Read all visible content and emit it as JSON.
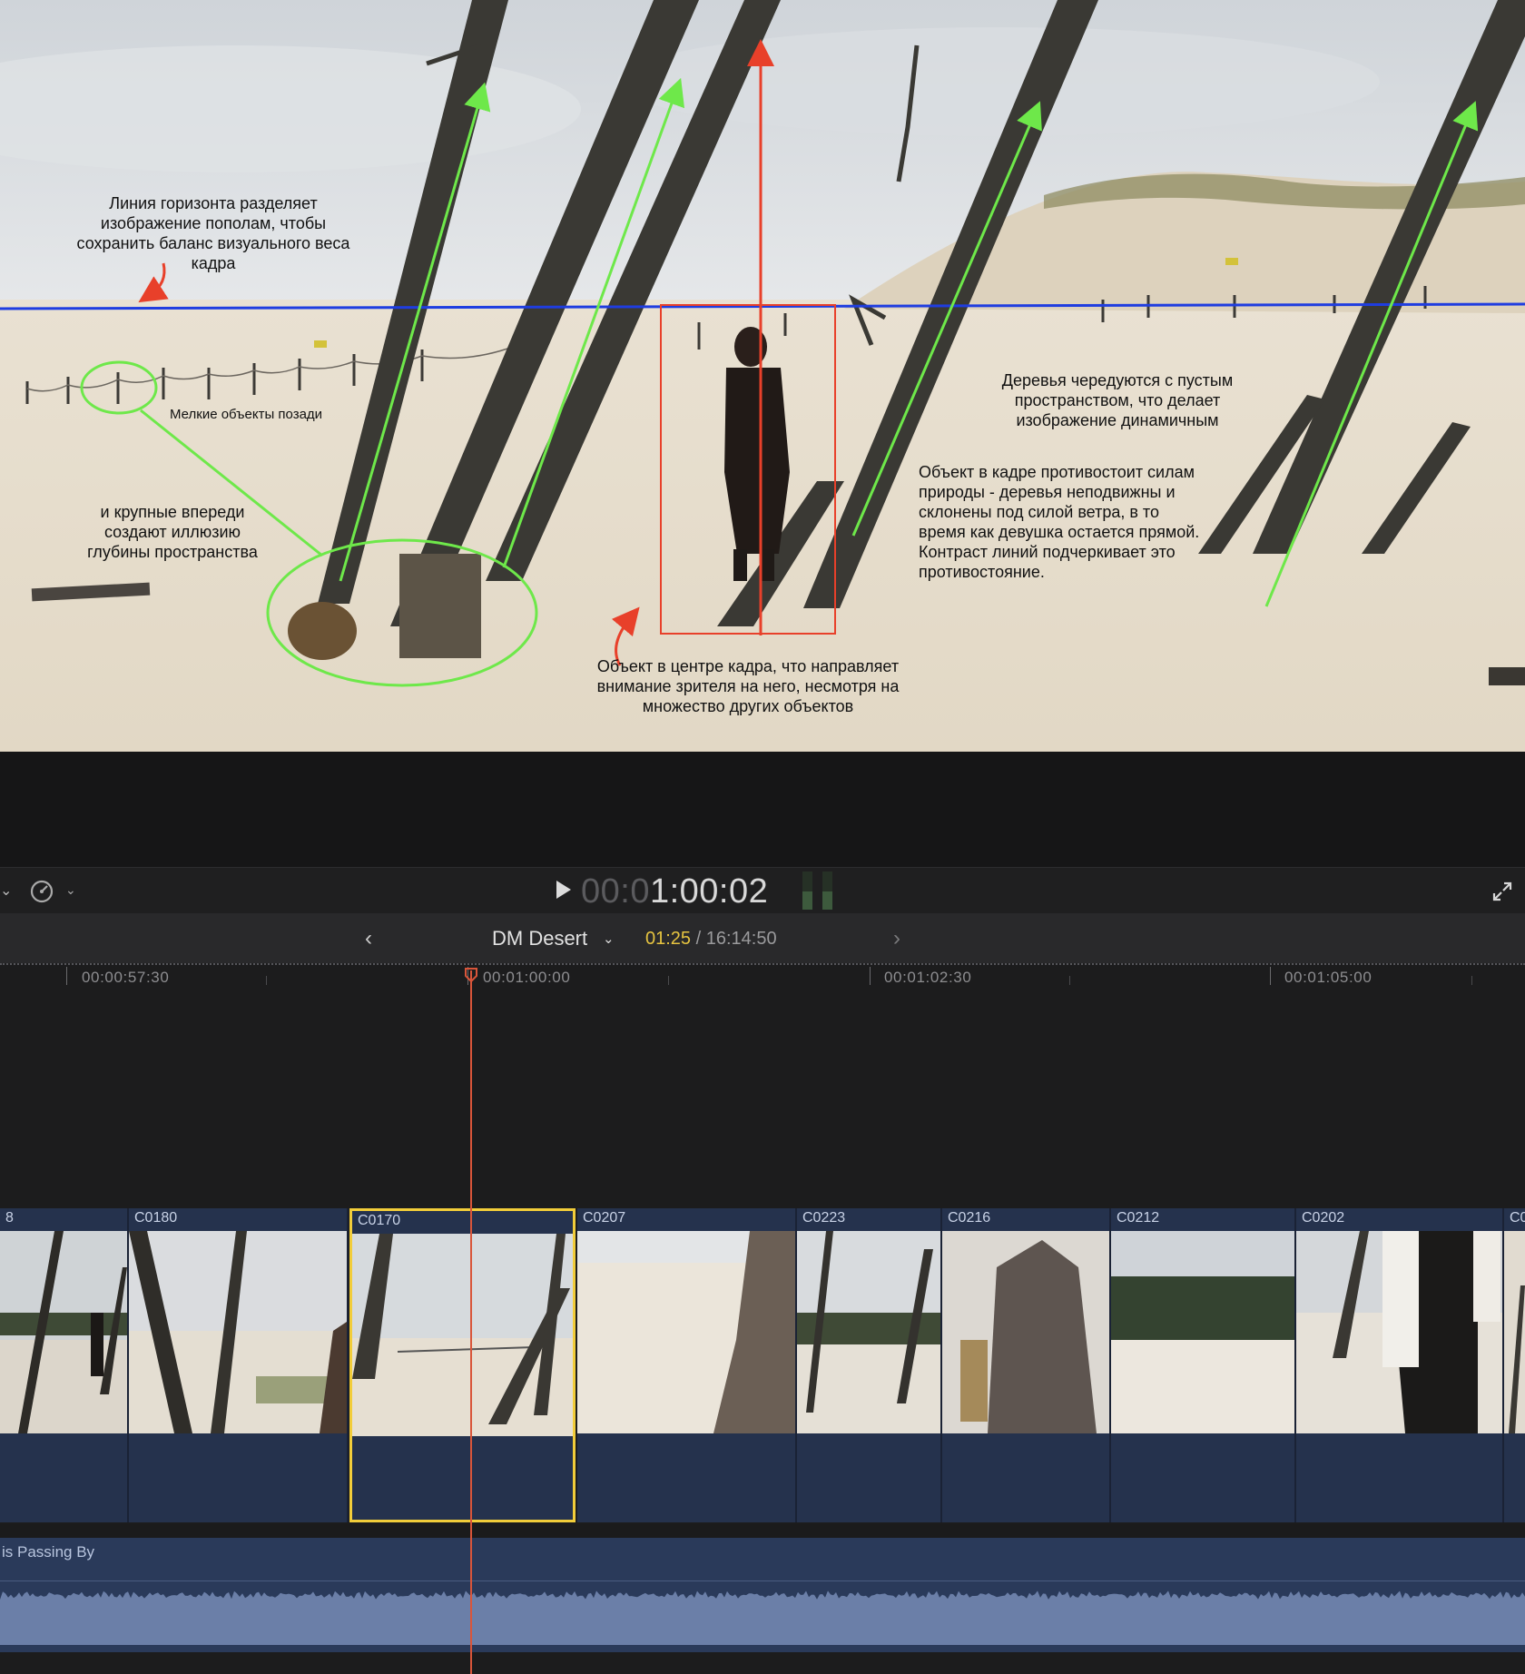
{
  "annotations": {
    "horizon": "Линия горизонта разделяет изображение пополам, чтобы сохранить баланс визуального веса кадра",
    "small_objects": "Мелкие объекты позади",
    "large_objects": "и крупные впереди создают иллюзию глубины пространства",
    "center_object": "Объект в центре кадра, что направляет внимание зрителя на него, несмотря на множество других объектов",
    "trees_alternate": "Деревья чередуются с пустым пространством, что делает изображение динамичным",
    "object_resists": "Объект в кадре противостоит силам природы - деревья неподвижны и склонены под силой ветра, в то время как девушка остается прямой. Контраст линий подчеркивает это противостояние."
  },
  "transport": {
    "timecode_dim": "00:0",
    "timecode_bright": "1:00:02"
  },
  "timeline": {
    "project_name": "DM Desert",
    "current_duration": "01:25",
    "separator": " / ",
    "total_duration": "16:14:50",
    "ruler": [
      "00:00:57:30",
      "00:01:00:00",
      "00:01:02:30",
      "00:01:05:00"
    ]
  },
  "clips": [
    {
      "name": "8"
    },
    {
      "name": "C0180"
    },
    {
      "name": "C0170",
      "selected": true
    },
    {
      "name": "C0207"
    },
    {
      "name": "C0223"
    },
    {
      "name": "C0216"
    },
    {
      "name": "C0212"
    },
    {
      "name": "C0202"
    },
    {
      "name": "C0"
    }
  ],
  "audio": {
    "name": "is Passing By"
  },
  "colors": {
    "accent_yellow": "#f2cd3a",
    "playhead": "#d9553a",
    "horizon_line": "#1f3de0",
    "annotation_green": "#6ee84a",
    "annotation_red": "#e8402a"
  }
}
